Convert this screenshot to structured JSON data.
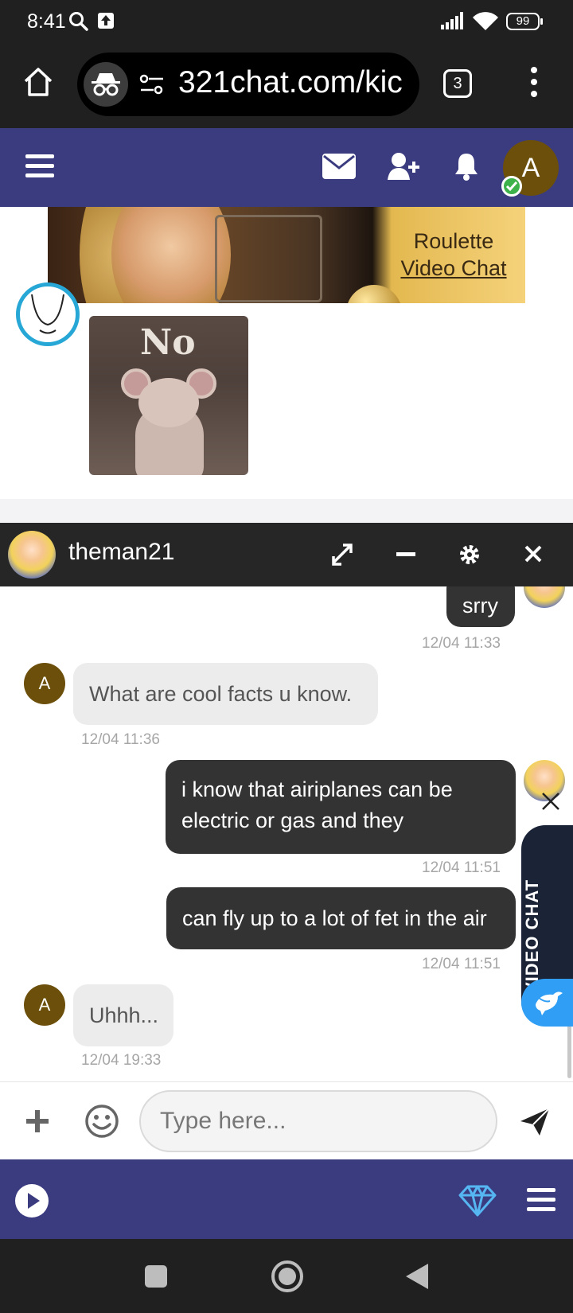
{
  "status_bar": {
    "time": "8:41",
    "battery": "99",
    "icons": [
      "search-icon",
      "upload-icon",
      "signal-icon",
      "wifi-icon",
      "battery-icon"
    ]
  },
  "browser": {
    "url": "321chat.com/kic",
    "tab_count": "3",
    "icons": [
      "home-icon",
      "incognito-icon",
      "site-settings-icon",
      "menu-dots-icon"
    ]
  },
  "site_header": {
    "user_initial": "A",
    "icons": [
      "hamburger-menu-icon",
      "envelope-icon",
      "add-friend-icon",
      "bell-icon"
    ],
    "colors": {
      "bar": "#3b3c80",
      "avatar": "#6b4f0a",
      "online": "#3db24a"
    }
  },
  "banner": {
    "line1": "Roulette",
    "line2": "Video Chat"
  },
  "background_chat": {
    "gif_text": "No"
  },
  "chat_window": {
    "peer_name": "theman21",
    "controls": [
      "expand-icon",
      "minimize-icon",
      "gear-icon",
      "close-icon"
    ],
    "messages": [
      {
        "from": "me",
        "text": "srry",
        "time": "12/04 11:33"
      },
      {
        "from": "them",
        "initial": "A",
        "text": "What are cool facts u know.",
        "time": "12/04 11:36"
      },
      {
        "from": "me",
        "text": "i know that airiplanes can be electric or gas and they",
        "time": "12/04 11:51"
      },
      {
        "from": "me",
        "text": "can fly up to a lot of fet in the air",
        "time": "12/04 11:51"
      },
      {
        "from": "them",
        "initial": "A",
        "text": "Uhhh...",
        "time": "12/04 19:33"
      }
    ]
  },
  "video_chat_tab": {
    "label": "VIDEO CHAT",
    "colors": {
      "tab": "#1b2437",
      "bird": "#2f9ef4"
    }
  },
  "composer": {
    "placeholder": "Type here...",
    "icons": [
      "plus-icon",
      "emoji-icon",
      "send-icon"
    ]
  },
  "footer": {
    "icons": [
      "play-icon",
      "diamond-icon",
      "hamburger-menu-icon"
    ]
  },
  "android_nav": {
    "icons": [
      "recents-icon",
      "home-icon",
      "back-icon"
    ]
  }
}
